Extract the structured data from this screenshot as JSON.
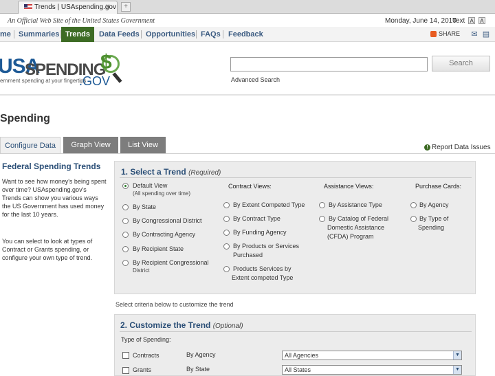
{
  "browser": {
    "tab_title": "Trends | USAspending.gov",
    "tab_close": "×",
    "new_tab": "+"
  },
  "official": {
    "banner": "An Official Web Site of the United States Government",
    "date": "Monday, June 14, 2010",
    "text_size_label": "Text",
    "text_size_small": "A",
    "text_size_large": "A"
  },
  "nav": {
    "items": [
      "me",
      "Summaries",
      "Trends",
      "Data Feeds",
      "Opportunities",
      "FAQs",
      "Feedback"
    ],
    "share_label": "SHARE",
    "active_color": "#3d6b24"
  },
  "header": {
    "logo_usa": "USA",
    "logo_spending": "SPENDING",
    "logo_gov": ".GOV",
    "logo_dollar": "$",
    "tagline": "ernment spending at your fingertips",
    "search_placeholder": "",
    "search_button": "Search",
    "advanced_search": "Advanced Search"
  },
  "page_title": "Spending",
  "tabs": [
    "Configure Data",
    "Graph View",
    "List View"
  ],
  "report_issues": "Report Data Issues",
  "intro": {
    "title": "Federal Spending Trends",
    "p1": "Want to see how money's being spent over time? USAspending.gov's Trends can show you various ways the US Government has used money for the last 10 years.",
    "p2": "You can select to look at types of Contract or Grants spending, or configure your own type of trend."
  },
  "section1": {
    "title": "1. Select a Trend",
    "title_note": "(Required)",
    "col_contract": "Contract Views:",
    "col_assistance": "Assistance Views:",
    "col_purchase": "Purchase Cards:",
    "left_options": [
      {
        "label": "Default View",
        "sub": "(All spending over time)",
        "selected": true
      },
      {
        "label": "By State",
        "sub": "",
        "selected": false
      },
      {
        "label": "By Congressional District",
        "sub": "",
        "selected": false
      },
      {
        "label": "By Contracting Agency",
        "sub": "",
        "selected": false
      },
      {
        "label": "By Recipient State",
        "sub": "",
        "selected": false
      },
      {
        "label": "By Recipient Congressional",
        "sub": "District",
        "selected": false
      }
    ],
    "contract_options": [
      {
        "label": "By Extent Competed Type",
        "sub": ""
      },
      {
        "label": "By Contract Type",
        "sub": ""
      },
      {
        "label": "By Funding Agency",
        "sub": ""
      },
      {
        "label": "By Products or Services",
        "sub": "Purchased"
      },
      {
        "label": "Products Services by",
        "sub": "Extent competed Type"
      }
    ],
    "assistance_options": [
      {
        "label": "By Assistance Type",
        "sub": "",
        "sub2": ""
      },
      {
        "label": "By Catalog of Federal",
        "sub": "Domestic Assistance",
        "sub2": "(CFDA) Program"
      }
    ],
    "purchase_options": [
      {
        "label": "By Agency",
        "sub": ""
      },
      {
        "label": "By Type of",
        "sub": "Spending"
      }
    ]
  },
  "criteria_note": "Select criteria below to customize the trend",
  "section2": {
    "title": "2. Customize the Trend",
    "title_note": "(Optional)",
    "type_label": "Type of Spending:",
    "rows": [
      {
        "type": "Contracts",
        "by": "By Agency",
        "select": "All Agencies"
      },
      {
        "type": "Grants",
        "by": "By State",
        "select": "All States"
      }
    ]
  }
}
